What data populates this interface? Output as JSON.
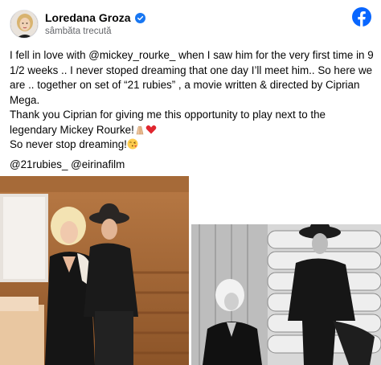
{
  "post": {
    "author": "Loredana Groza",
    "timestamp": "sâmbăta trecută",
    "paragraphs": [
      "I fell in love with @mickey_rourke_ when I saw him for the very first time in 9 1/2 weeks .. I never stoped dreaming that one day I’ll meet him.. So here we are .. together on set of “21 rubies” , a movie written & directed by Ciprian Mega.",
      "Thank you Ciprian for giving me this opportunity to play next to the legendary Mickey Rourke!",
      "So never stop dreaming!"
    ],
    "tags": "@21rubies_ @eirinafilm",
    "icons": {
      "avatar": "profile-avatar",
      "verified": "verified-badge-icon",
      "platform": "facebook-logo-icon",
      "emoji_hands": "folded-hands-emoji",
      "emoji_heart": "red-heart-emoji",
      "emoji_kiss": "face-blowing-kiss-emoji"
    },
    "colors": {
      "facebook_blue": "#0866ff",
      "verified_blue": "#1877f2",
      "secondary_text": "#65676b",
      "heart_red": "#e0262f"
    }
  },
  "photos": [
    {
      "kind": "color-photo",
      "subject": "couple-on-set"
    },
    {
      "kind": "black-and-white-photo",
      "subject": "couple-seated"
    }
  ]
}
